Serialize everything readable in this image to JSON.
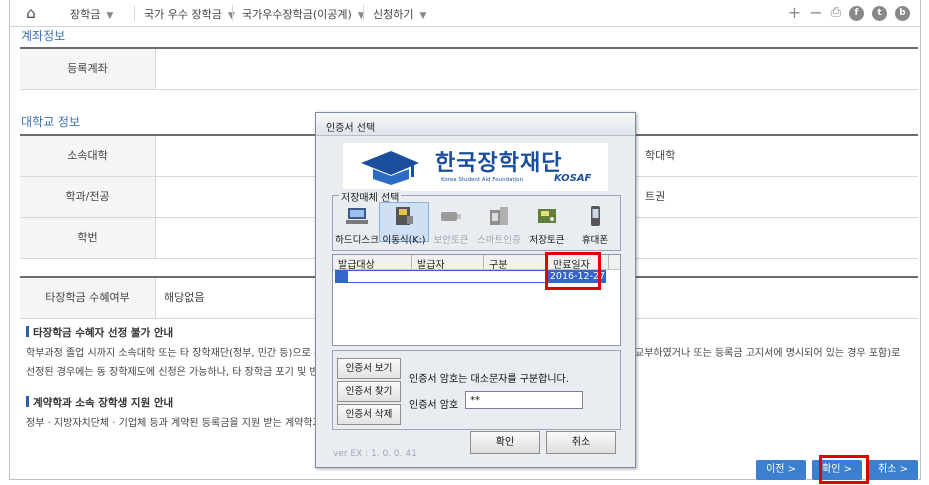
{
  "nav": {
    "items": [
      "장학금",
      "국가 우수 장학금",
      "국가우수장학금(이공계)",
      "신청하기"
    ]
  },
  "account_section": {
    "title": "계좌정보",
    "rows": [
      {
        "label": "등록계좌",
        "value": ""
      }
    ]
  },
  "univ_section": {
    "title": "대학교 정보",
    "rows": [
      {
        "label": "소속대학",
        "value": "",
        "right": "학대학"
      },
      {
        "label": "학과/전공",
        "value": "",
        "right": "트권"
      },
      {
        "label": "학번",
        "value": "",
        "right": ""
      }
    ]
  },
  "other_section": {
    "rows": [
      {
        "label": "타장학금 수혜여부",
        "value": "해당없음"
      }
    ]
  },
  "notice1": {
    "heading": "타장학금 수혜자 선정 불가 안내",
    "line1_left": "학부과정 졸업 시까지 소속대학 또는 타 장학재단(정부, 민간 등)으로 부",
    "line1_right": "교부하였거나 또는 등록금 고지서에 명시되어 있는 경우 포함)로",
    "line2_left": "선정된 경우에는 동 장학제도에 신청은 가능하나, 타 장학금 포기 및 반"
  },
  "notice2": {
    "heading": "계약학과 소속 장학생 지원 안내",
    "line1_left": "정부 · 지방자치단체 · 기업체 등과 계약된 등록금을 지원 받는 계약학과"
  },
  "footer": {
    "prev": "이전 >",
    "confirm": "확인 >",
    "cancel": "취소 >"
  },
  "dialog": {
    "title": "인증서 선택",
    "logo_kr": "한국장학재단",
    "logo_en": "Korea Student Aid Foundation",
    "logo_brand": "KOSAF",
    "storage_legend": "저장매체 선택",
    "devices": [
      {
        "label": "하드디스크",
        "icon": "hard-disk-icon"
      },
      {
        "label": "이동식(K:)",
        "icon": "removable-disk-icon"
      },
      {
        "label": "보안토큰",
        "icon": "security-token-icon"
      },
      {
        "label": "스마트인증",
        "icon": "smart-auth-icon"
      },
      {
        "label": "저장토큰",
        "icon": "storage-token-icon"
      },
      {
        "label": "휴대폰",
        "icon": "mobile-phone-icon"
      }
    ],
    "columns": [
      "발급대상",
      "발급자",
      "구분",
      "만료일자"
    ],
    "cert_row": {
      "expiry": "2016-12-27"
    },
    "btn_view": "인증서 보기",
    "btn_find": "인증서 찾기",
    "btn_delete": "인증서 삭제",
    "case_note": "인증서 암호는 대소문자를 구분합니다.",
    "password_label": "인증서 암호",
    "password_value": "**",
    "ok": "확인",
    "cancel": "취소",
    "version": "ver EX : 1. 0. 0. 41"
  }
}
